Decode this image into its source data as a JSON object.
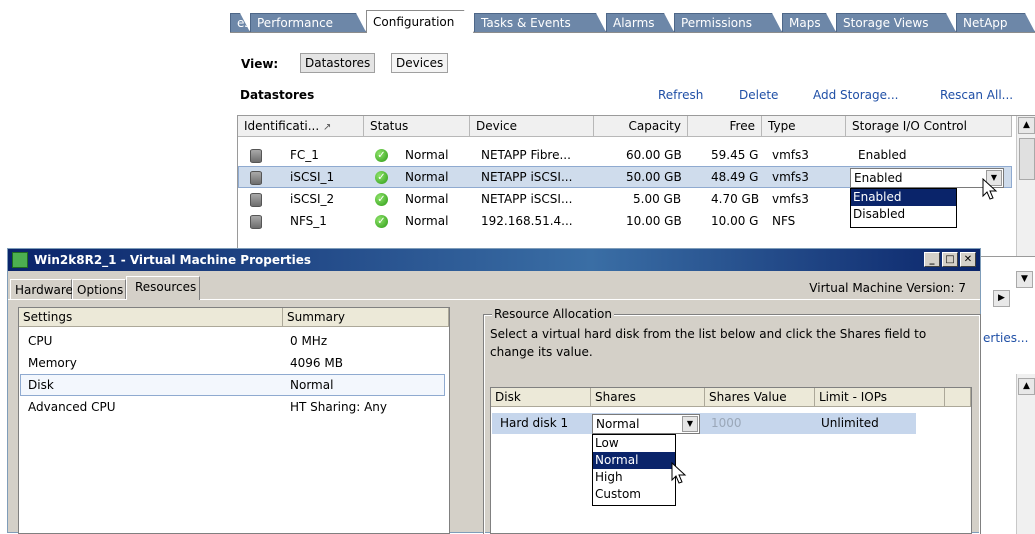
{
  "tabs": [
    {
      "label": "es"
    },
    {
      "label": "Performance"
    },
    {
      "label": "Configuration"
    },
    {
      "label": "Tasks & Events"
    },
    {
      "label": "Alarms"
    },
    {
      "label": "Permissions"
    },
    {
      "label": "Maps"
    },
    {
      "label": "Storage Views"
    },
    {
      "label": "NetApp"
    }
  ],
  "view": {
    "label": "View:",
    "datastores_btn": "Datastores",
    "devices_btn": "Devices"
  },
  "datastores": {
    "title": "Datastores",
    "actions": {
      "refresh": "Refresh",
      "delete": "Delete",
      "add": "Add Storage...",
      "rescan": "Rescan All..."
    },
    "columns": [
      "Identificati...",
      "Status",
      "Device",
      "Capacity",
      "Free",
      "Type",
      "Storage I/O Control"
    ],
    "sort_glyph": "↗",
    "rows": [
      {
        "id": "FC_1",
        "status": "Normal",
        "device": "NETAPP Fibre...",
        "capacity": "60.00 GB",
        "free": "59.45 G",
        "type": "vmfs3",
        "sioc": "Enabled"
      },
      {
        "id": "iSCSI_1",
        "status": "Normal",
        "device": "NETAPP iSCSI...",
        "capacity": "50.00 GB",
        "free": "48.49 G",
        "type": "vmfs3",
        "sioc": "Enabled"
      },
      {
        "id": "iSCSI_2",
        "status": "Normal",
        "device": "NETAPP iSCSI...",
        "capacity": "5.00 GB",
        "free": "4.70 GB",
        "type": "vmfs3",
        "sioc": ""
      },
      {
        "id": "NFS_1",
        "status": "Normal",
        "device": "192.168.51.4...",
        "capacity": "10.00 GB",
        "free": "10.00 G",
        "type": "NFS",
        "sioc": ""
      }
    ],
    "sioc_dropdown": {
      "value": "Enabled",
      "options": [
        "Enabled",
        "Disabled"
      ],
      "highlighted": "Enabled"
    },
    "peek_text": "erties..."
  },
  "vm_window": {
    "title": "Win2k8R2_1 - Virtual Machine Properties",
    "tabs": [
      "Hardware",
      "Options",
      "Resources"
    ],
    "version": "Virtual Machine Version: 7",
    "settings_header": "Settings",
    "summary_header": "Summary",
    "settings": [
      {
        "name": "CPU",
        "summary": "0 MHz"
      },
      {
        "name": "Memory",
        "summary": "4096 MB"
      },
      {
        "name": "Disk",
        "summary": "Normal"
      },
      {
        "name": "Advanced CPU",
        "summary": "HT Sharing: Any"
      }
    ],
    "resource_allocation": {
      "title": "Resource Allocation",
      "instructions": "Select a virtual hard disk from the list below and click the Shares field to change its value.",
      "columns": [
        "Disk",
        "Shares",
        "Shares Value",
        "Limit - IOPs"
      ],
      "row": {
        "disk": "Hard disk 1",
        "shares": "Normal",
        "shares_value": "1000",
        "limit": "Unlimited"
      },
      "shares_options": [
        "Low",
        "Normal",
        "High",
        "Custom"
      ],
      "highlighted": "Normal"
    }
  }
}
